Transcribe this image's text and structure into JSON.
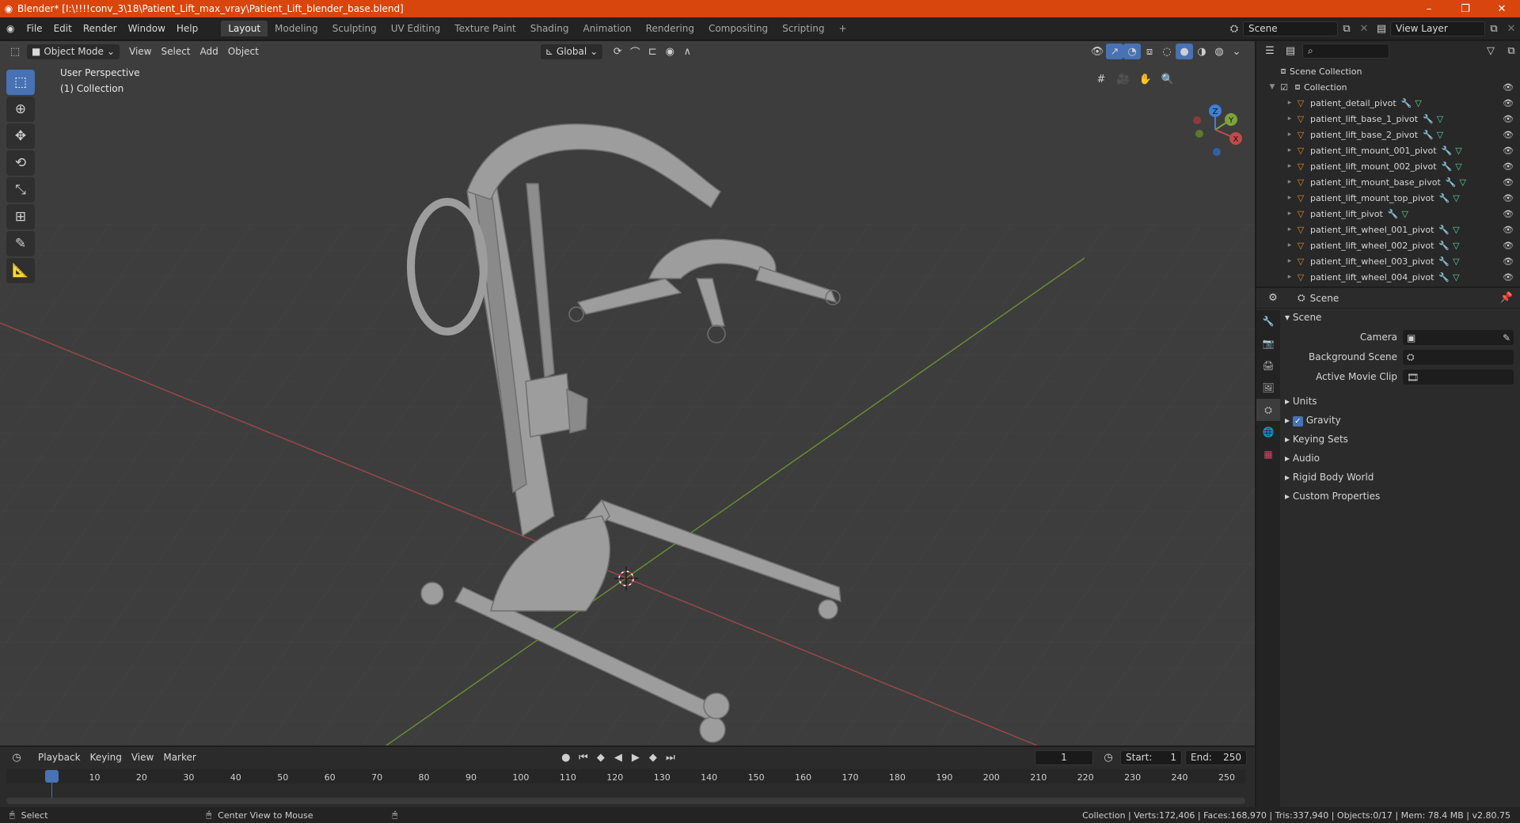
{
  "window": {
    "title": "Blender* [I:\\!!!!conv_3\\18\\Patient_Lift_max_vray\\Patient_Lift_blender_base.blend]",
    "minimize": "–",
    "maximize": "❐",
    "close": "✕"
  },
  "menus": [
    "File",
    "Edit",
    "Render",
    "Window",
    "Help"
  ],
  "workspaces": [
    "Layout",
    "Modeling",
    "Sculpting",
    "UV Editing",
    "Texture Paint",
    "Shading",
    "Animation",
    "Rendering",
    "Compositing",
    "Scripting"
  ],
  "add_workspace": "+",
  "scene_field": "Scene",
  "view_layer_field": "View Layer",
  "viewport": {
    "mode": "Object Mode",
    "menus": [
      "View",
      "Select",
      "Add",
      "Object"
    ],
    "transform_orientation": "Global",
    "info_line1": "User Perspective",
    "info_line2": "(1) Collection",
    "gizmo_labels": {
      "z": "Z",
      "y": "Y",
      "x": "X"
    }
  },
  "outliner": {
    "search_placeholder": "",
    "scene_collection": "Scene Collection",
    "collection": "Collection",
    "objects": [
      "patient_detail_pivot",
      "patient_lift_base_1_pivot",
      "patient_lift_base_2_pivot",
      "patient_lift_mount_001_pivot",
      "patient_lift_mount_002_pivot",
      "patient_lift_mount_base_pivot",
      "patient_lift_mount_top_pivot",
      "patient_lift_pivot",
      "patient_lift_wheel_001_pivot",
      "patient_lift_wheel_002_pivot",
      "patient_lift_wheel_003_pivot",
      "patient_lift_wheel_004_pivot"
    ]
  },
  "properties": {
    "context": "Scene",
    "panel": "Scene",
    "camera_label": "Camera",
    "background_scene_label": "Background Scene",
    "active_movie_clip_label": "Active Movie Clip",
    "sections": [
      "Units",
      "Gravity",
      "Keying Sets",
      "Audio",
      "Rigid Body World",
      "Custom Properties"
    ],
    "gravity_checked": true
  },
  "timeline": {
    "menus": [
      "Playback",
      "Keying",
      "View",
      "Marker"
    ],
    "current_frame": "1",
    "start_label": "Start:",
    "start": "1",
    "end_label": "End:",
    "end": "250",
    "ticks": [
      "1",
      "10",
      "20",
      "30",
      "40",
      "50",
      "60",
      "70",
      "80",
      "90",
      "100",
      "110",
      "120",
      "130",
      "140",
      "150",
      "160",
      "170",
      "180",
      "190",
      "200",
      "210",
      "220",
      "230",
      "240",
      "250"
    ]
  },
  "statusbar": {
    "left_action": "Select",
    "middle_action": "Center View to Mouse",
    "stats": "Collection | Verts:172,406 | Faces:168,970 | Tris:337,940 | Objects:0/17 | Mem: 78.4 MB | v2.80.75"
  },
  "colors": {
    "title_bar": "#d8460e",
    "accent": "#4772b3",
    "x_axis": "#c44a4a",
    "y_axis": "#7ea33b",
    "z_axis": "#3e7fd9"
  }
}
